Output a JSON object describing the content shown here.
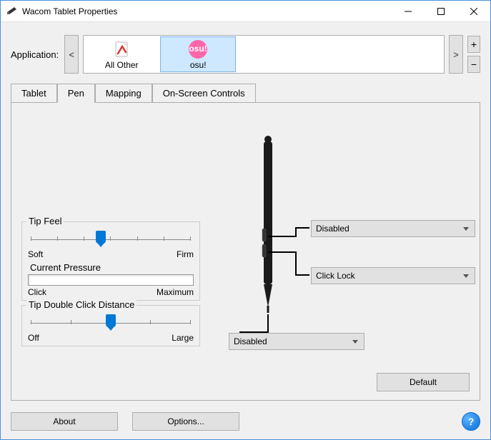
{
  "window": {
    "title": "Wacom Tablet Properties"
  },
  "application": {
    "label": "Application:",
    "items": [
      {
        "label": "All Other",
        "icon": "app-icon"
      },
      {
        "label": "osu!",
        "icon": "osu-icon"
      }
    ],
    "selected_index": 1
  },
  "tabs": {
    "items": [
      "Tablet",
      "Pen",
      "Mapping",
      "On-Screen Controls"
    ],
    "active_index": 1
  },
  "pen": {
    "tip_feel": {
      "label": "Tip Feel",
      "min_label": "Soft",
      "max_label": "Firm",
      "value_pct": 44
    },
    "current_pressure": {
      "label": "Current Pressure",
      "min_label": "Click",
      "max_label": "Maximum"
    },
    "tip_double_click": {
      "label": "Tip Double Click Distance",
      "min_label": "Off",
      "max_label": "Large",
      "value_pct": 50
    },
    "upper_button": "Disabled",
    "lower_button": "Click Lock",
    "tip_action": "Disabled",
    "default_button": "Default"
  },
  "footer": {
    "about": "About",
    "options": "Options...",
    "help_tooltip": "Help"
  }
}
